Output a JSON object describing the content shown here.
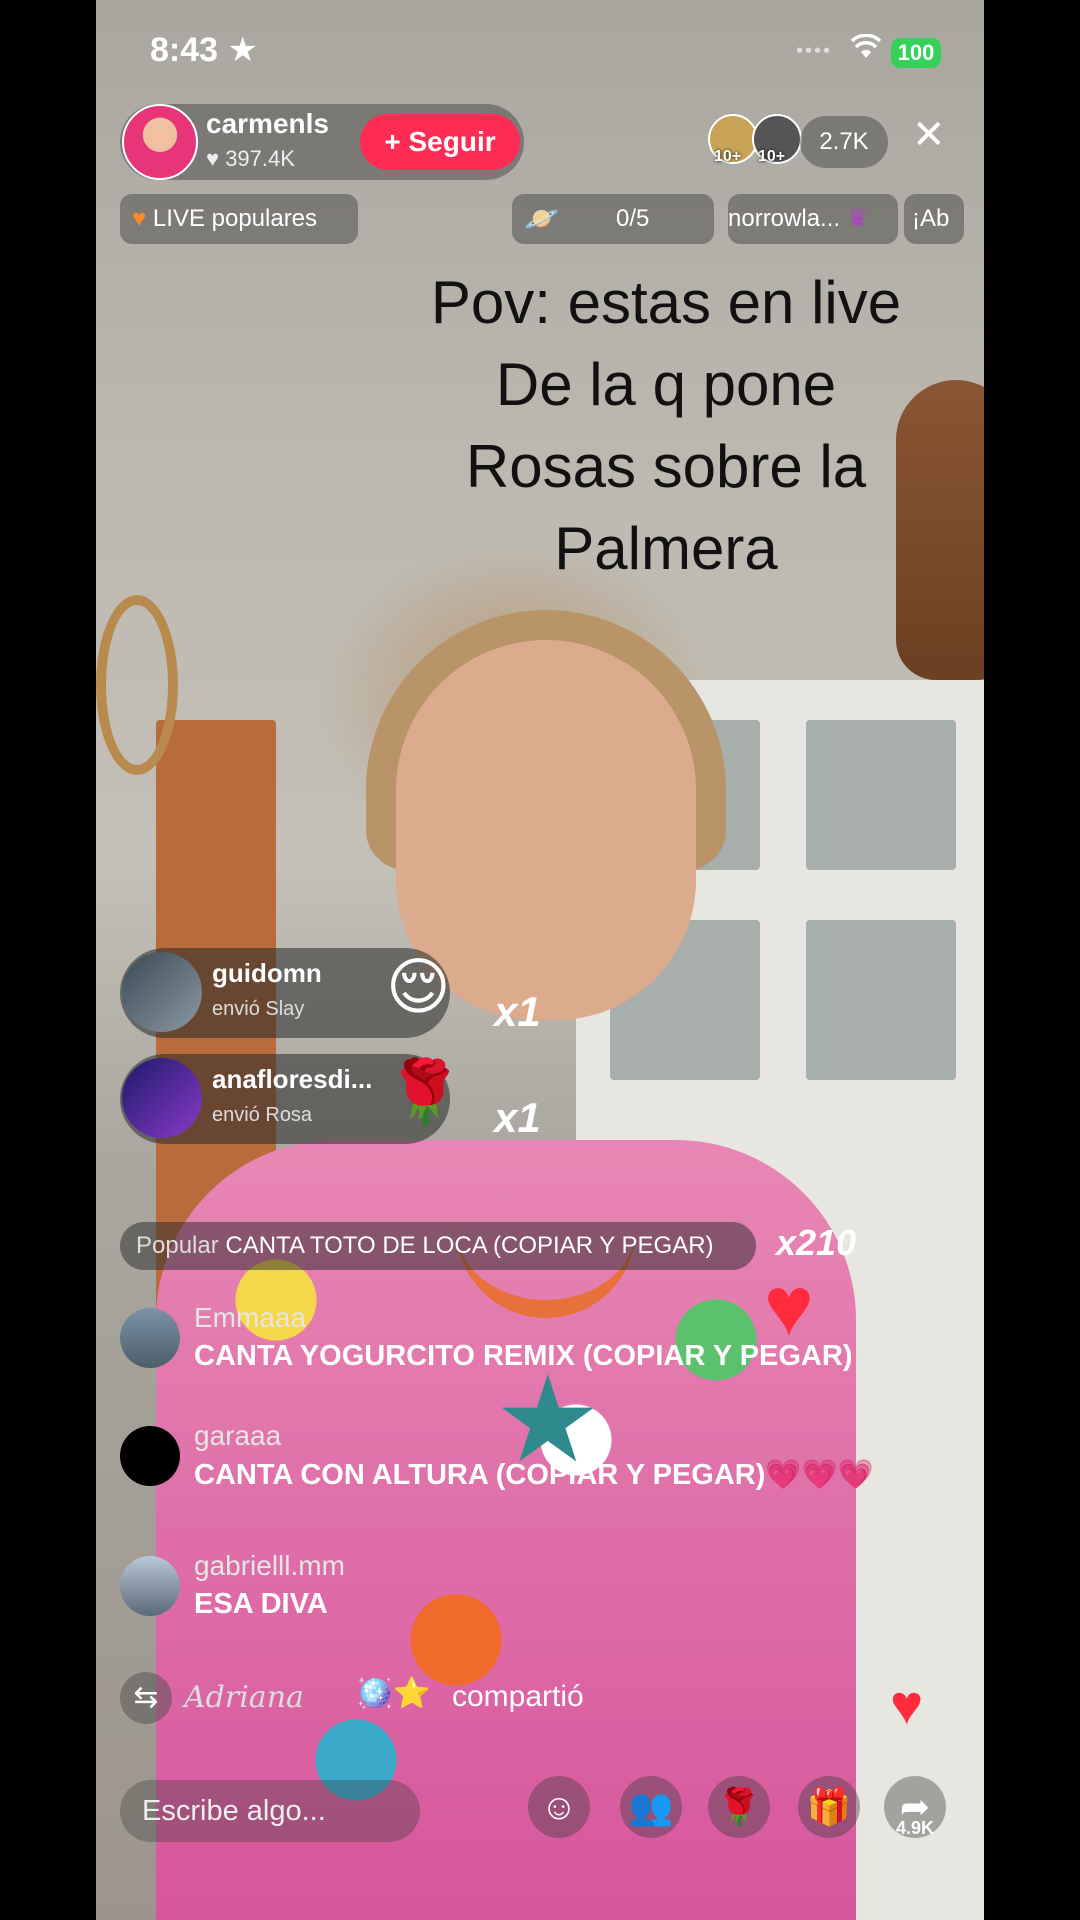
{
  "status_bar": {
    "time": "8:43",
    "battery": "100"
  },
  "host": {
    "name": "carmenls",
    "likes": "397.4K",
    "follow_label": "+ Seguir"
  },
  "viewers": {
    "badge1": "10+",
    "badge2": "10+",
    "count": "2.7K"
  },
  "top_row": {
    "popular_live": "LIVE populares",
    "goal": "0/5",
    "ticker1": "norrowla...",
    "ticker2": "¡Ab"
  },
  "overlay_text": [
    "Pov: estas en live",
    "De la q pone",
    "Rosas sobre la",
    "Palmera"
  ],
  "gifts": [
    {
      "user": "guidomn",
      "action": "envió Slay",
      "multiplier": "x1"
    },
    {
      "user": "anafloresdi...",
      "action": "envió Rosa",
      "multiplier": "x1"
    }
  ],
  "popular_banner": {
    "label": "Popular",
    "text": "CANTA TOTO DE LOCA (COPIAR Y PEGAR)",
    "multiplier": "x210"
  },
  "comments": [
    {
      "user": "Emmaaa",
      "text": "CANTA YOGURCITO REMIX (COPIAR Y PEGAR)"
    },
    {
      "user": "garaaa",
      "text": "CANTA CON ALTURA (COPIAR Y PEGAR)💗💗💗"
    },
    {
      "user": "gabrielll.mm",
      "text": "ESA DIVA"
    }
  ],
  "share_event": {
    "name": "𝐴𝑑𝑟𝑖𝑎𝑛𝑎",
    "emoji": "🪩⭐",
    "verb": "compartió"
  },
  "bottom_bar": {
    "placeholder": "Escribe algo...",
    "share_count": "4.9K"
  },
  "icons": [
    "star-icon",
    "wifi-icon",
    "battery-icon",
    "heart-icon",
    "close-icon",
    "flame-icon",
    "planet-icon",
    "festival-icon",
    "repost-icon",
    "emoji-face-icon",
    "people-icon",
    "rose-icon",
    "gift-icon",
    "share-arrow-icon"
  ],
  "colors": {
    "follow": "#fe2c55",
    "like_heart": "#ff2a3c",
    "battery": "#36d15a"
  }
}
